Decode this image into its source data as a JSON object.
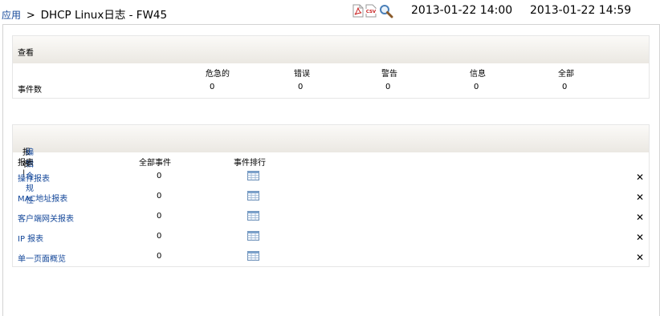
{
  "breadcrumb": {
    "app": "应用",
    "separator": ">",
    "title": "DHCP Linux日志 - FW45"
  },
  "toolbar": {
    "pdf_icon": "pdf-export-icon",
    "csv_icon": "csv-export-icon",
    "search_icon": "magnifier-icon"
  },
  "time_range": {
    "start": "2013-01-22 14:00",
    "end": "2013-01-22 14:59"
  },
  "summary": {
    "title": "查看",
    "columns": [
      "危急的",
      "错误",
      "警告",
      "信息",
      "全部"
    ],
    "row_label": "事件数",
    "values": [
      "0",
      "0",
      "0",
      "0",
      "0"
    ]
  },
  "reports": {
    "title": "报表 |",
    "edit_link": "编辑合规性",
    "columns": {
      "name": "报表",
      "events": "全部事件",
      "ranking": "事件排行"
    },
    "rows": [
      {
        "name": "操作报表",
        "count": "0"
      },
      {
        "name": "MAC地址报表",
        "count": "0"
      },
      {
        "name": "客户端网关报表",
        "count": "0"
      },
      {
        "name": "IP 报表",
        "count": "0"
      },
      {
        "name": "单一页面概览",
        "count": "0"
      }
    ],
    "remove_glyph": "✕"
  },
  "colors": {
    "link": "#15489a",
    "header_gradient_top": "#fbfaf8",
    "header_gradient_bottom": "#ebe8e2",
    "border": "#e6e6e6"
  }
}
